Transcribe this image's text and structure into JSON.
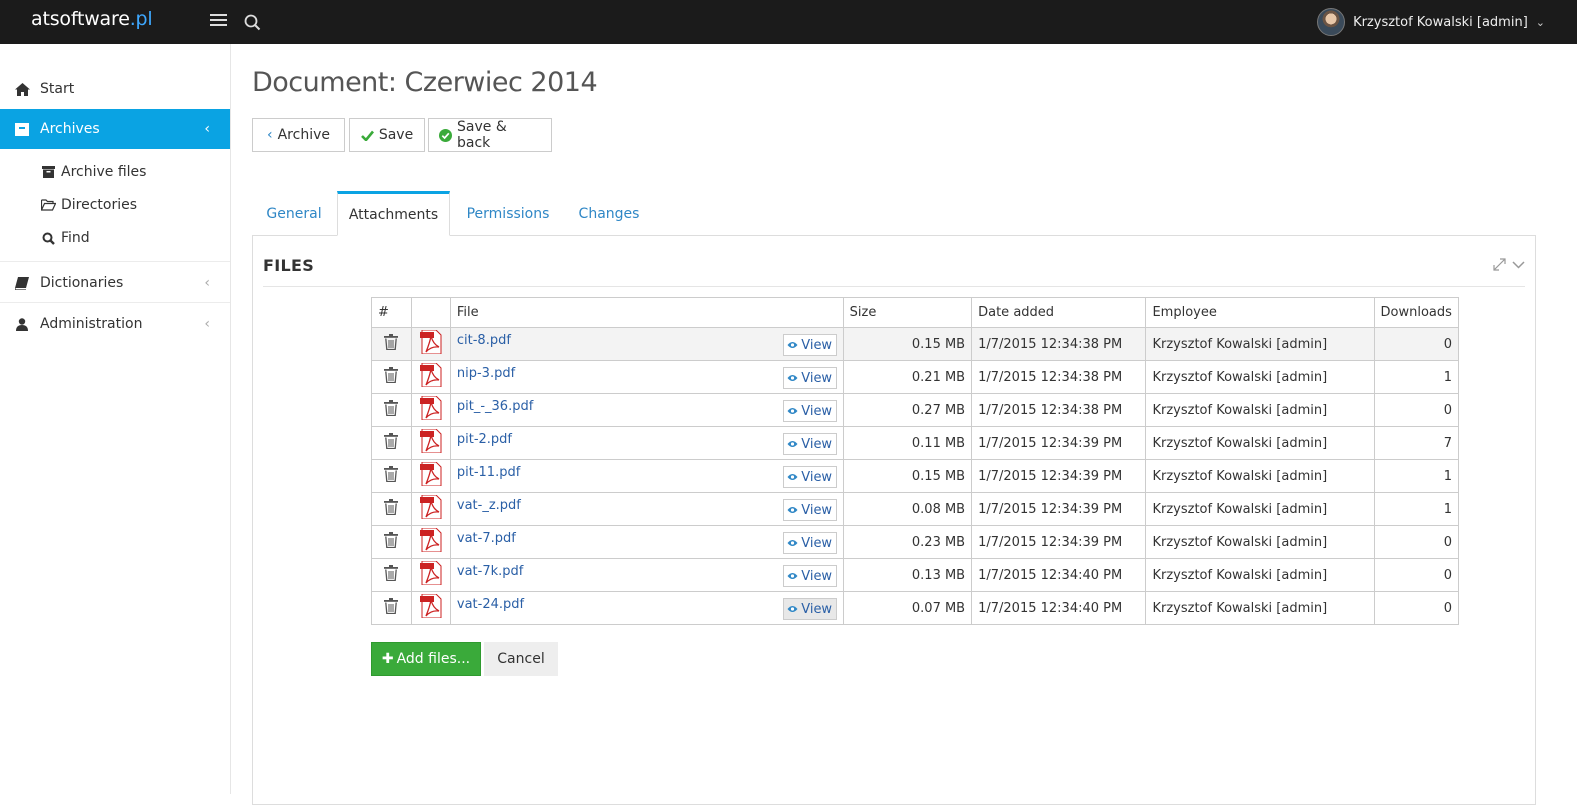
{
  "header": {
    "brand_main": "atsoftware",
    "brand_tld": ".pl",
    "user_name": "Krzysztof Kowalski [admin]"
  },
  "sidebar": {
    "start": "Start",
    "archives": "Archives",
    "archive_files": "Archive files",
    "directories": "Directories",
    "find": "Find",
    "dictionaries": "Dictionaries",
    "administration": "Administration"
  },
  "page": {
    "title": "Document: Czerwiec 2014"
  },
  "toolbar": {
    "archive": "Archive",
    "save": "Save",
    "save_back": "Save & back"
  },
  "tabs": {
    "general": "General",
    "attachments": "Attachments",
    "permissions": "Permissions",
    "changes": "Changes"
  },
  "panel": {
    "title": "FILES"
  },
  "table": {
    "headers": {
      "num": "#",
      "file": "File",
      "size": "Size",
      "date": "Date added",
      "employee": "Employee",
      "downloads": "Downloads"
    },
    "view_label": "View",
    "rows": [
      {
        "file": "cit-8.pdf",
        "size": "0.15 MB",
        "date": "1/7/2015 12:34:38 PM",
        "employee": "Krzysztof Kowalski [admin]",
        "downloads": "0"
      },
      {
        "file": "nip-3.pdf",
        "size": "0.21 MB",
        "date": "1/7/2015 12:34:38 PM",
        "employee": "Krzysztof Kowalski [admin]",
        "downloads": "1"
      },
      {
        "file": "pit_-_36.pdf",
        "size": "0.27 MB",
        "date": "1/7/2015 12:34:38 PM",
        "employee": "Krzysztof Kowalski [admin]",
        "downloads": "0"
      },
      {
        "file": "pit-2.pdf",
        "size": "0.11 MB",
        "date": "1/7/2015 12:34:39 PM",
        "employee": "Krzysztof Kowalski [admin]",
        "downloads": "7"
      },
      {
        "file": "pit-11.pdf",
        "size": "0.15 MB",
        "date": "1/7/2015 12:34:39 PM",
        "employee": "Krzysztof Kowalski [admin]",
        "downloads": "1"
      },
      {
        "file": "vat-_z.pdf",
        "size": "0.08 MB",
        "date": "1/7/2015 12:34:39 PM",
        "employee": "Krzysztof Kowalski [admin]",
        "downloads": "1"
      },
      {
        "file": "vat-7.pdf",
        "size": "0.23 MB",
        "date": "1/7/2015 12:34:39 PM",
        "employee": "Krzysztof Kowalski [admin]",
        "downloads": "0"
      },
      {
        "file": "vat-7k.pdf",
        "size": "0.13 MB",
        "date": "1/7/2015 12:34:40 PM",
        "employee": "Krzysztof Kowalski [admin]",
        "downloads": "0"
      },
      {
        "file": "vat-24.pdf",
        "size": "0.07 MB",
        "date": "1/7/2015 12:34:40 PM",
        "employee": "Krzysztof Kowalski [admin]",
        "downloads": "0"
      }
    ]
  },
  "actions": {
    "add_files": "Add files...",
    "cancel": "Cancel"
  }
}
